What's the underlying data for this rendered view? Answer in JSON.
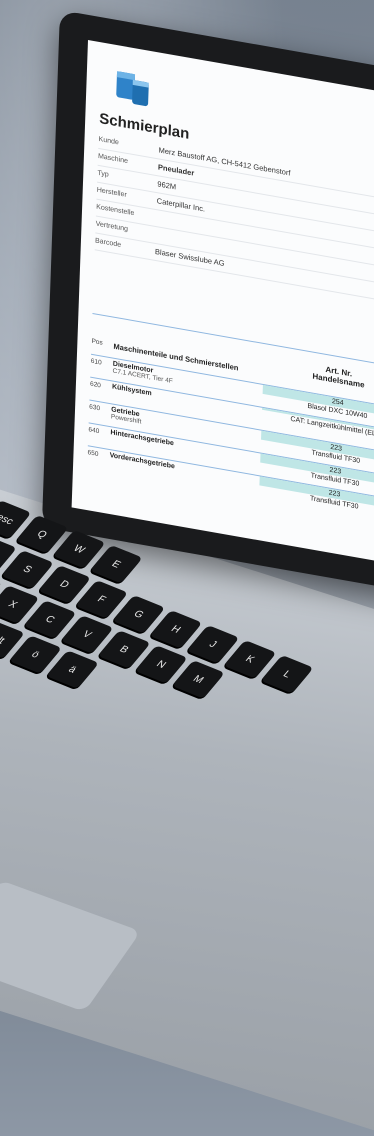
{
  "document": {
    "title": "Schmierplan",
    "meta": [
      {
        "key": "Kunde",
        "value": "Merz Baustoff AG, CH-5412 Gebenstorf"
      },
      {
        "key": "Maschine",
        "value": "Pneulader"
      },
      {
        "key": "Typ",
        "value": "962M"
      },
      {
        "key": "Hersteller",
        "value": "Caterpillar Inc."
      },
      {
        "key": "Kostenstelle",
        "value": ""
      },
      {
        "key": "Vertretung",
        "value": ""
      },
      {
        "key": "Barcode",
        "value": "Blaser Swisslube AG"
      }
    ],
    "table": {
      "header_pos": "Pos",
      "header_name": "Maschinenteile und Schmierstellen",
      "header_art": "Art. Nr.",
      "header_trade": "Handelsname",
      "rows": [
        {
          "pos": "610",
          "name": "Dieselmotor",
          "sub": "C7.1 ACERT, Tier 4F",
          "num": "254",
          "trade": "Blasol DXC 10W40"
        },
        {
          "pos": "620",
          "name": "Kühlsystem",
          "sub": "",
          "num": "",
          "trade": "CAT: Langzeitkühlmittel (ELC)"
        },
        {
          "pos": "630",
          "name": "Getriebe",
          "sub": "Powershift",
          "num": "223",
          "trade": "Transfluid TF30"
        },
        {
          "pos": "640",
          "name": "Hinterachsgetriebe",
          "sub": "",
          "num": "223",
          "trade": "Transfluid TF30"
        },
        {
          "pos": "650",
          "name": "Vorderachsgetriebe",
          "sub": "",
          "num": "223",
          "trade": "Transfluid TF30"
        }
      ]
    }
  },
  "keyboard": {
    "labels": [
      "esc",
      "Q",
      "W",
      "E",
      "A",
      "S",
      "D",
      "F",
      "G",
      "H",
      "J",
      "K",
      "L",
      "Z",
      "X",
      "C",
      "V",
      "B",
      "N",
      "M",
      "cmd",
      "alt",
      "ö",
      "ä"
    ]
  }
}
